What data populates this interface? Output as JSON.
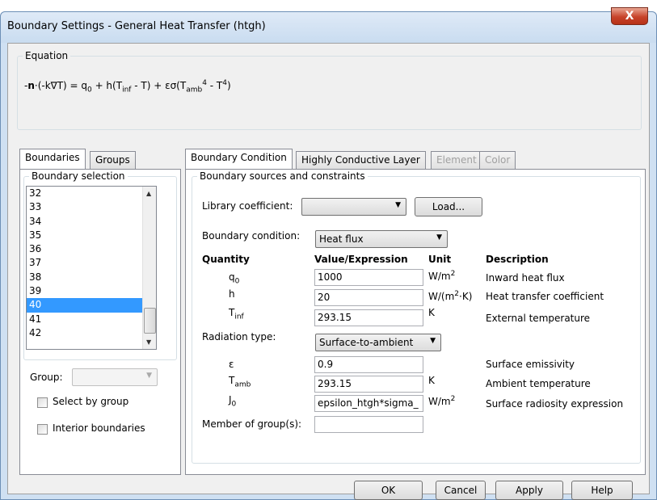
{
  "window": {
    "title": "Boundary Settings - General Heat Transfer (htgh)",
    "close_label": "X"
  },
  "equation": {
    "legend": "Equation"
  },
  "left_tabs": [
    "Boundaries",
    "Groups"
  ],
  "boundary_selection": {
    "legend": "Boundary selection",
    "items": [
      "32",
      "33",
      "34",
      "35",
      "36",
      "37",
      "38",
      "39",
      "40",
      "41",
      "42"
    ],
    "selected": "40",
    "group_label": "Group:",
    "select_by_group_label": "Select by group",
    "interior_boundaries_label": "Interior boundaries"
  },
  "right_tabs": [
    "Boundary Condition",
    "Highly Conductive Layer",
    "Element",
    "Color"
  ],
  "bc": {
    "legend": "Boundary sources and constraints",
    "library_coefficient_label": "Library coefficient:",
    "load_label": "Load...",
    "boundary_condition_label": "Boundary condition:",
    "boundary_condition_value": "Heat flux",
    "headers": {
      "quantity": "Quantity",
      "value": "Value/Expression",
      "unit": "Unit",
      "description": "Description"
    },
    "q0": {
      "value": "1000",
      "description": "Inward heat flux"
    },
    "h": {
      "label": "h",
      "value": "20",
      "description": "Heat transfer coefficient"
    },
    "tinf": {
      "value": "293.15",
      "unit": "K",
      "description": "External temperature"
    },
    "radiation_type_label": "Radiation type:",
    "radiation_type_value": "Surface-to-ambient",
    "eps": {
      "label": "ε",
      "value": "0.9",
      "description": "Surface emissivity"
    },
    "tamb": {
      "value": "293.15",
      "unit": "K",
      "description": "Ambient temperature"
    },
    "j0": {
      "value": "epsilon_htgh*sigma_",
      "description": "Surface radiosity expression"
    },
    "member_of_groups_label": "Member of group(s):"
  },
  "buttons": {
    "ok": "OK",
    "cancel": "Cancel",
    "apply": "Apply",
    "help": "Help"
  }
}
